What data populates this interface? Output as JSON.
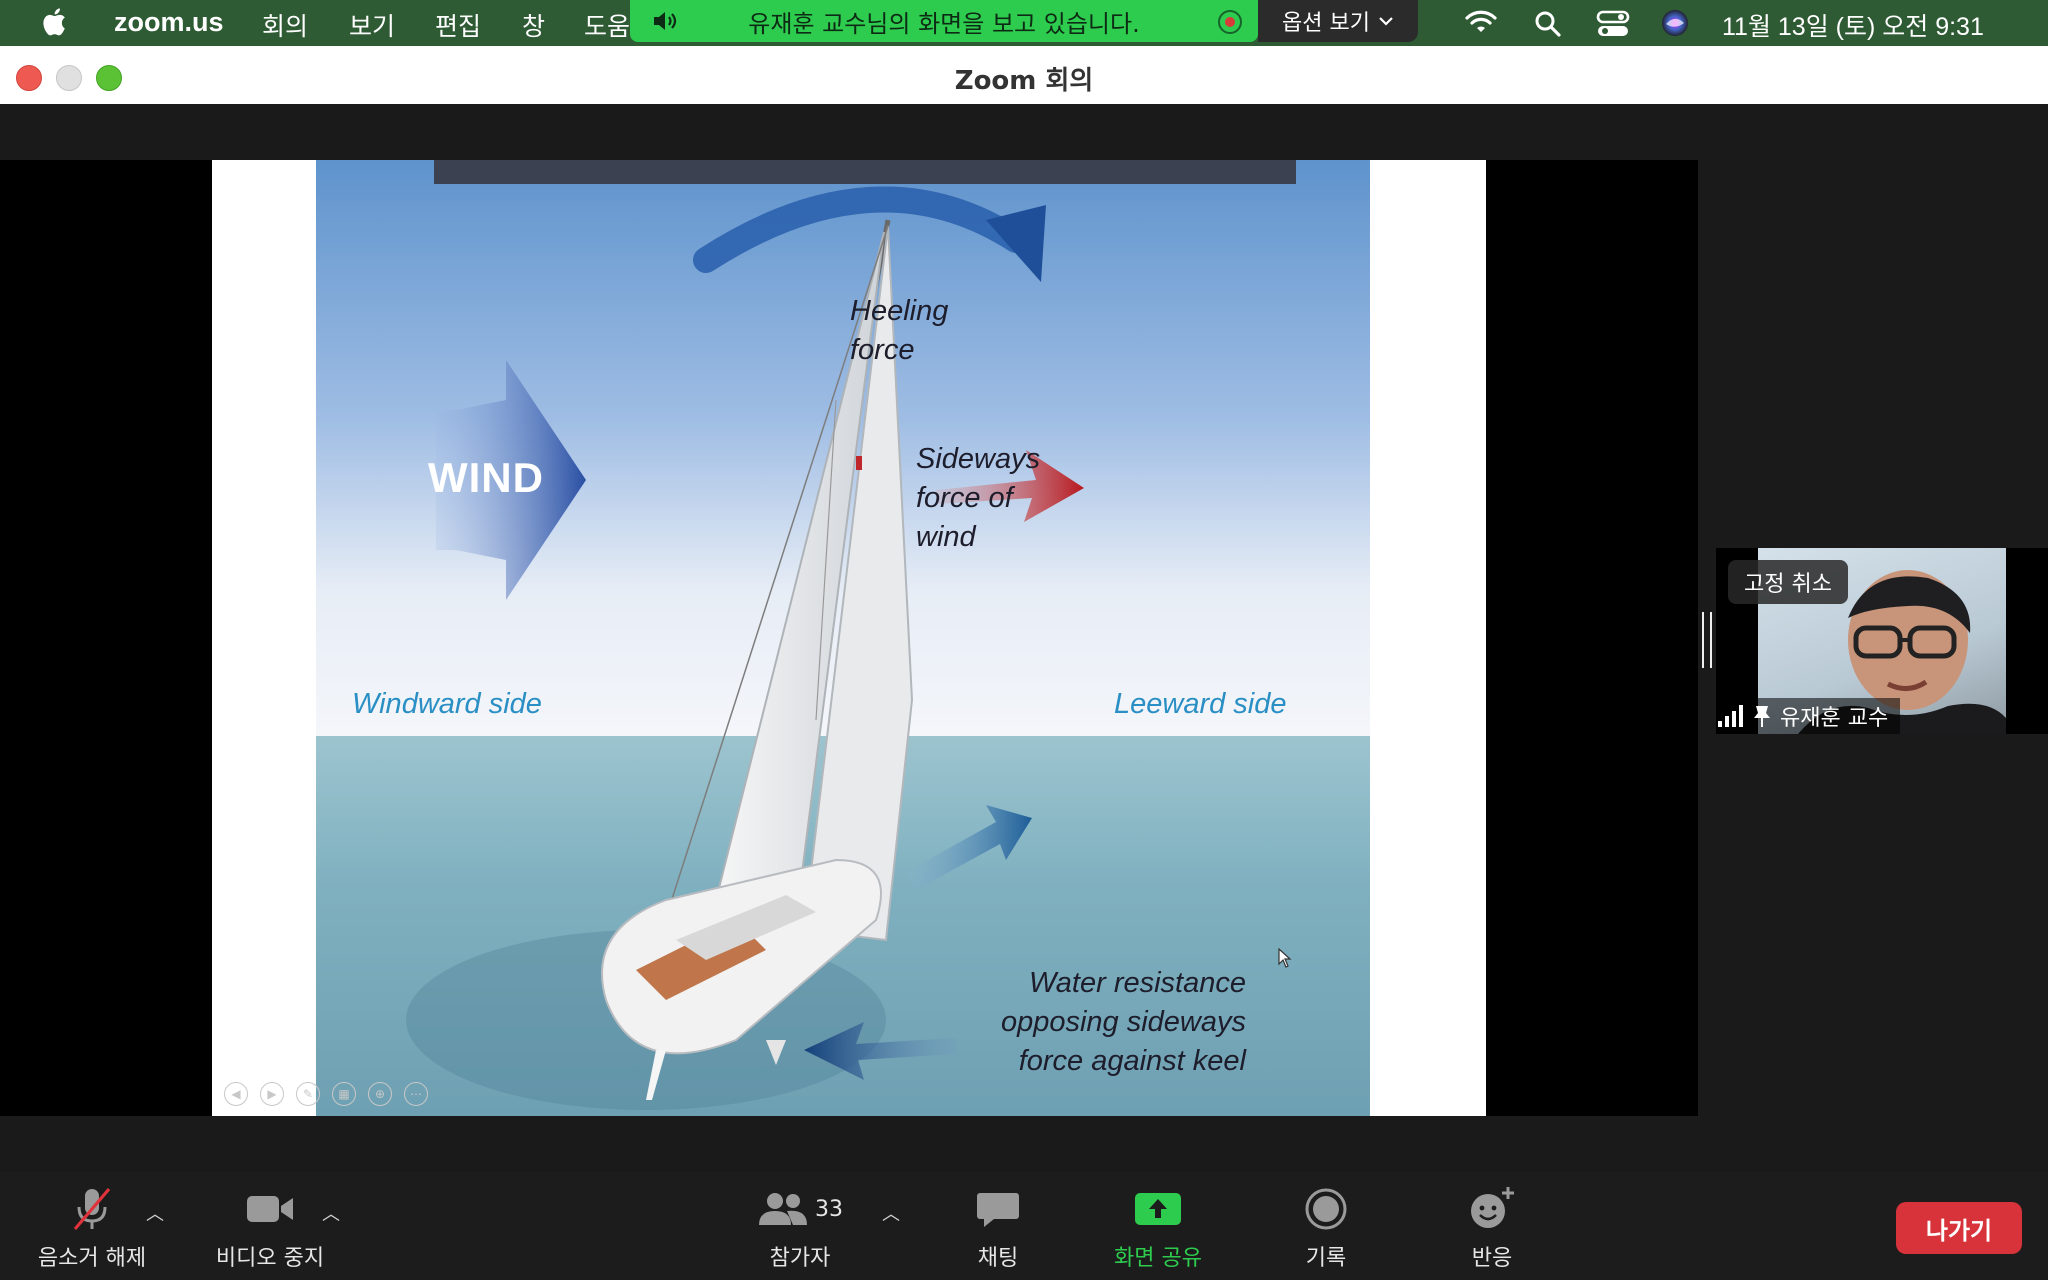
{
  "menubar": {
    "app_name": "zoom.us",
    "items": [
      "회의",
      "보기",
      "편집",
      "창",
      "도움"
    ],
    "datetime": "11월 13일 (토) 오전 9:31"
  },
  "share_banner": {
    "text": "유재훈 교수님의 화면을 보고 있습니다.",
    "options_label": "옵션 보기"
  },
  "window": {
    "title": "Zoom 회의"
  },
  "slide": {
    "wind": "WIND",
    "heeling": [
      "Heeling",
      "force"
    ],
    "sideways": [
      "Sideways",
      "force of",
      "wind"
    ],
    "windward": "Windward side",
    "leeward": "Leeward side",
    "water": [
      "Water resistance",
      "opposing sideways",
      "force against keel"
    ]
  },
  "video": {
    "unpin_label": "고정 취소",
    "participant_name": "유재훈 교수"
  },
  "toolbar": {
    "mute_label": "음소거 해제",
    "video_label": "비디오 중지",
    "participants_label": "참가자",
    "participants_count": "33",
    "chat_label": "채팅",
    "share_label": "화면 공유",
    "record_label": "기록",
    "reactions_label": "반응",
    "leave_label": "나가기"
  },
  "colors": {
    "menubar_bg": "#2e5b34",
    "banner_green": "#2ecc4e",
    "share_green": "#2ecc4e",
    "leave_red": "#d8323a"
  }
}
